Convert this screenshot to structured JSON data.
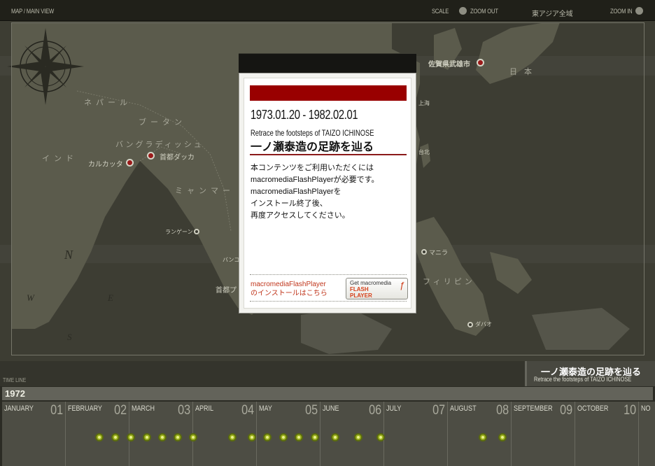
{
  "topbar": {
    "view_label": "MAP / MAIN VIEW",
    "scale_label": "SCALE",
    "zoom_out_label": "ZOOM OUT",
    "region_label": "東アジア全域",
    "zoom_in_label": "ZOOM IN"
  },
  "map": {
    "regions": [
      "ネパール",
      "ブータン",
      "バングラディッシュ",
      "インド",
      "ミャンマー",
      "フィリピン",
      "日本"
    ],
    "places": {
      "saga": "佐賀県武雄市",
      "kolkata": "カルカッタ",
      "dhaka": "首都ダッカ",
      "yangon": "ランゲーン",
      "bangkok": "バンコ",
      "phnompenh": "首都プ",
      "shanghai": "上海",
      "taipei": "台北",
      "manila": "マニラ",
      "davao": "ダバオ"
    },
    "compass": {
      "n": "N",
      "s": "S",
      "e": "E",
      "w": "W",
      "icon": "compass-rose-icon"
    }
  },
  "dialog": {
    "date_range": "1973.01.20 - 1982.02.01",
    "title_en": "Retrace the footsteps of TAIZO ICHINOSE",
    "title_jp": "一ノ瀬泰造の足跡を辿る",
    "body_lines": [
      "本コンテンツをご利用いただくには",
      "macromediaFlashPlayerが必要です。",
      "macromediaFlashPlayerを",
      "インストール終了後、",
      "再度アクセスしてください。"
    ],
    "install_lines": [
      "macromediaFlashPlayer",
      "のインストールはこちら"
    ],
    "flash_button": {
      "line1": "Get macromedia",
      "line2": "FLASH",
      "line3": "PLAYER",
      "glyph": "ƒ"
    },
    "accent_color": "#990000"
  },
  "title_plate": {
    "jp": "一ノ瀬泰造の足跡を辿る",
    "en": "Retrace the footsteps of TAIZO ICHINOSE"
  },
  "timeline": {
    "label": "TIME LINE",
    "year": "1972",
    "months": [
      {
        "name": "JANUARY",
        "num": "01"
      },
      {
        "name": "FEBRUARY",
        "num": "02"
      },
      {
        "name": "MARCH",
        "num": "03"
      },
      {
        "name": "APRIL",
        "num": "04"
      },
      {
        "name": "MAY",
        "num": "05"
      },
      {
        "name": "JUNE",
        "num": "06"
      },
      {
        "name": "JULY",
        "num": "07"
      },
      {
        "name": "AUGUST",
        "num": "08"
      },
      {
        "name": "SEPTEMBER",
        "num": "09"
      },
      {
        "name": "OCTOBER",
        "num": "10"
      },
      {
        "name": "NO",
        "num": ""
      }
    ],
    "event_dot_color": "#9bb01c"
  }
}
